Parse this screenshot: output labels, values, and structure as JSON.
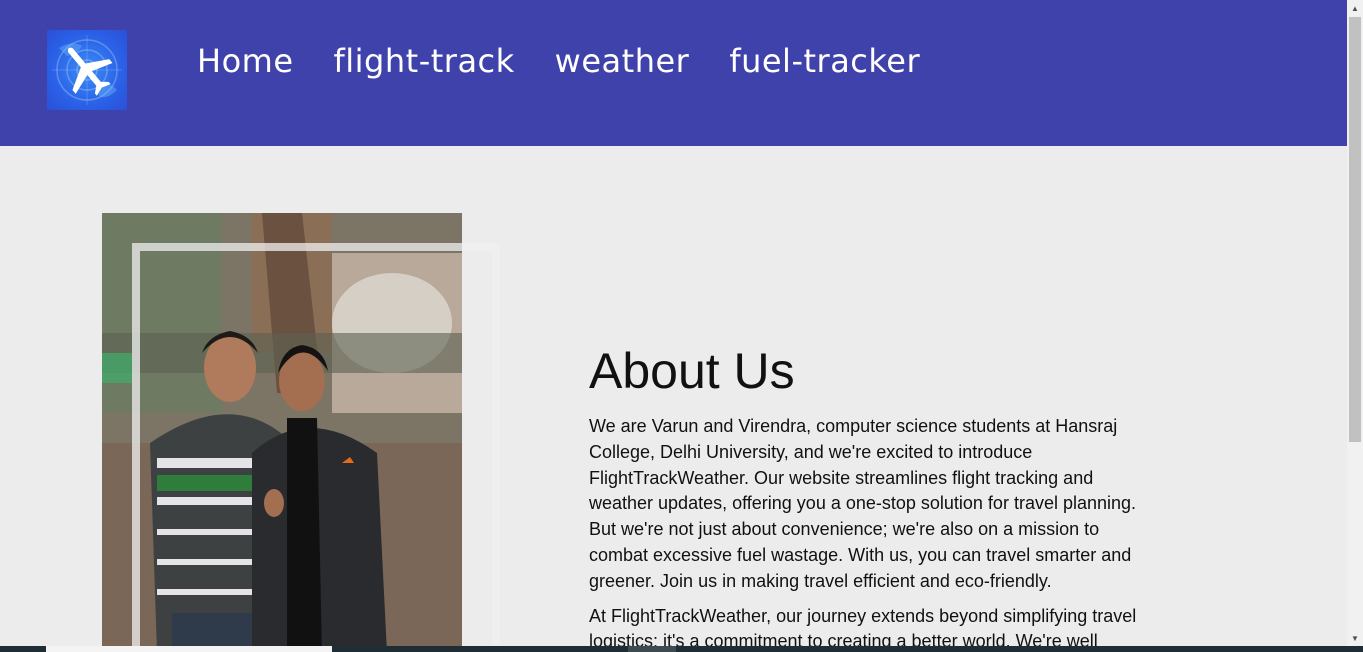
{
  "header": {
    "logo_icon": "airplane-logo-icon",
    "nav": [
      {
        "label": "Home"
      },
      {
        "label": "flight-track"
      },
      {
        "label": "weather"
      },
      {
        "label": "fuel-tracker"
      }
    ],
    "background_color": "#4042ac"
  },
  "about": {
    "title": "About Us",
    "paragraph1": "We are Varun and Virendra, computer science students at Hansraj College, Delhi University, and we're excited to introduce FlightTrackWeather. Our website streamlines flight tracking and weather updates, offering you a one-stop solution for travel planning. But we're not just about convenience; we're also on a mission to combat excessive fuel wastage. With us, you can travel smarter and greener. Join us in making travel efficient and eco-friendly.",
    "paragraph2": "At FlightTrackWeather, our journey extends beyond simplifying travel logistics; it's a commitment to creating a better world. We're well"
  },
  "photo": {
    "icon": "team-photo"
  },
  "colors": {
    "page_background": "#ececec",
    "text": "#111111"
  }
}
